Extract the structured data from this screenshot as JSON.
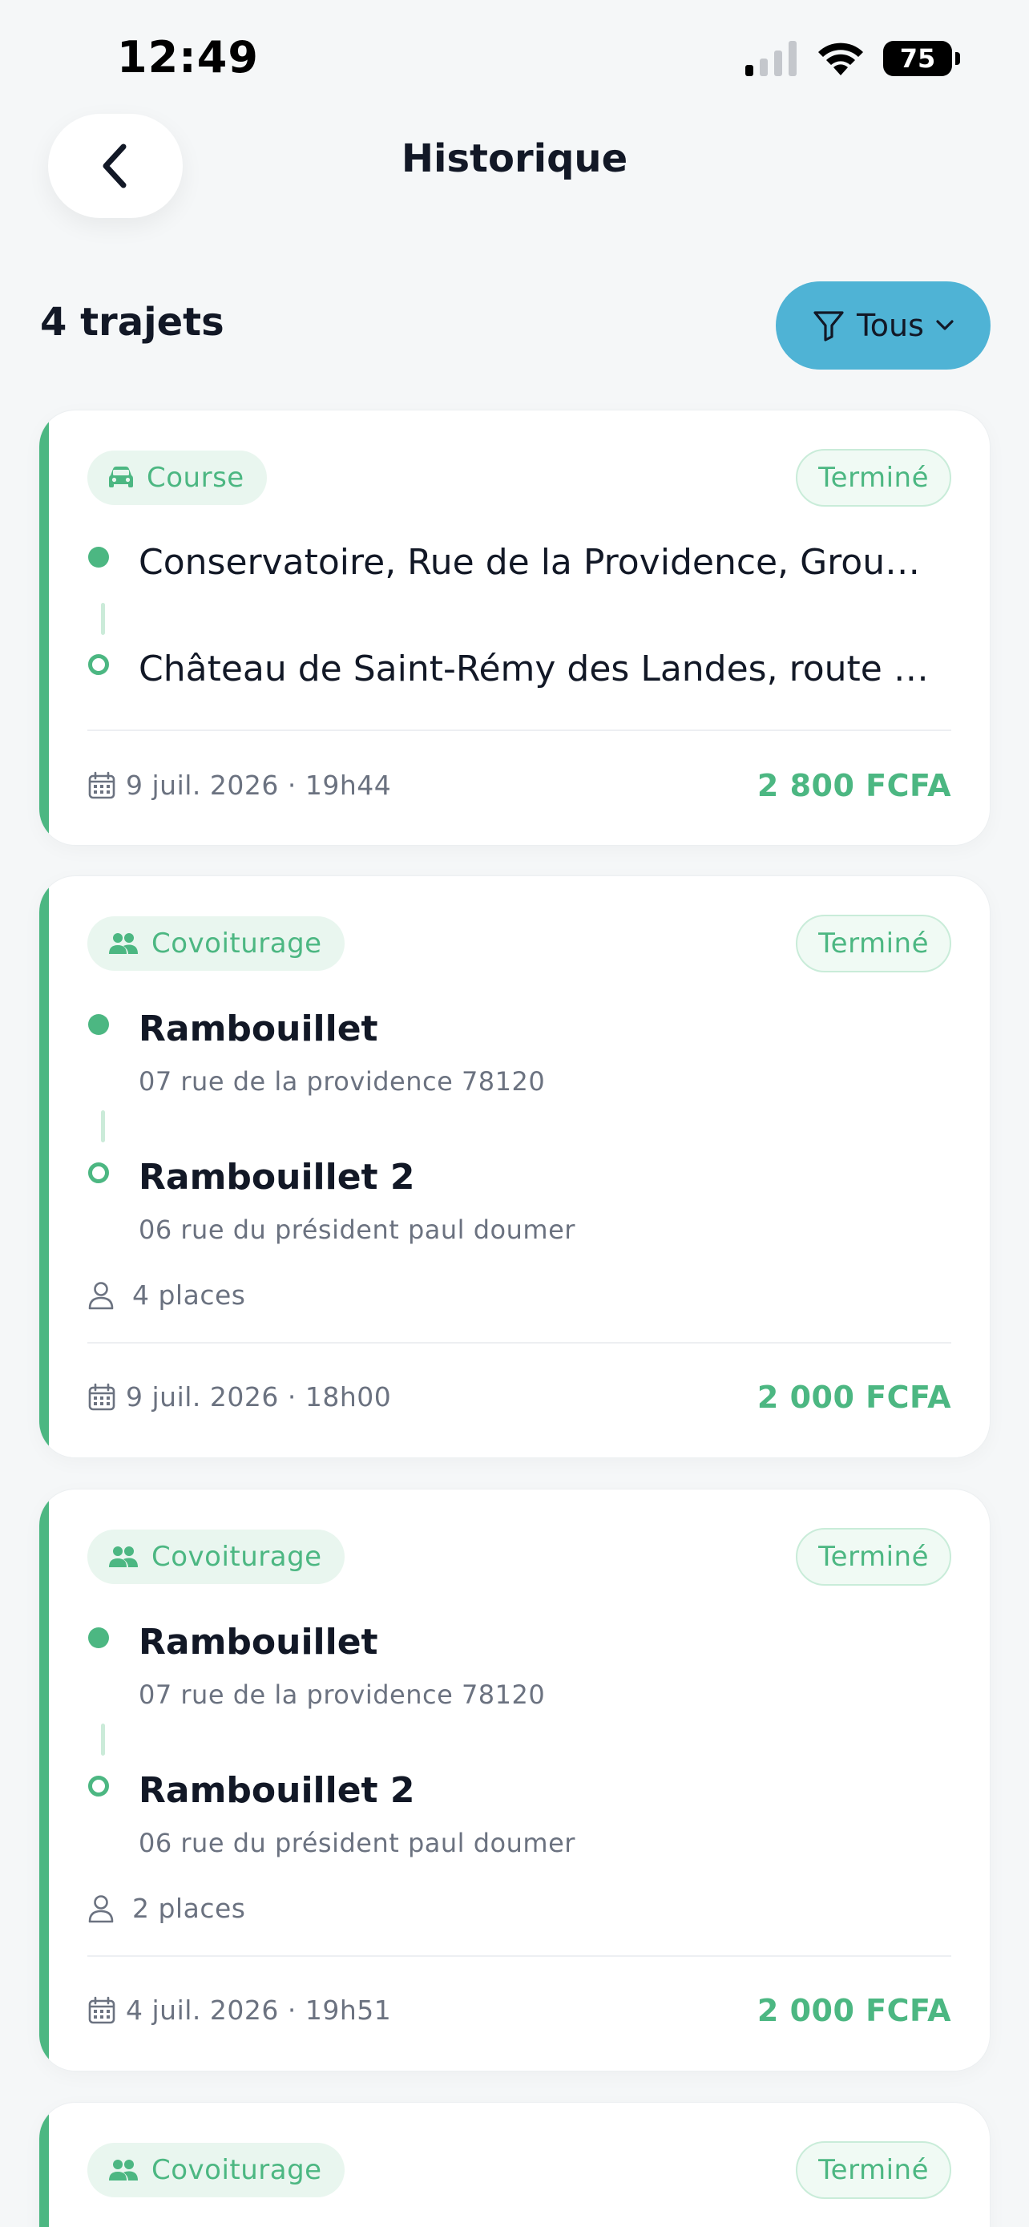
{
  "status_bar": {
    "time": "12:49",
    "battery": "75"
  },
  "header": {
    "title": "Historique"
  },
  "summary": {
    "count_label": "4 trajets",
    "filter_label": "Tous"
  },
  "colors": {
    "accent_green": "#4CB782",
    "filter_blue": "#4FB3D5",
    "background": "#F5F7F8"
  },
  "trips": [
    {
      "type_label": "Course",
      "type_icon": "car-icon",
      "status": "Terminé",
      "from": "Conservatoire, Rue de la Providence, Groupe Scolaire…",
      "to": "Château de Saint-Rémy des Landes, route de Sonchamp…",
      "date": "9 juil. 2026 · 19h44",
      "price": "2 800 FCFA"
    },
    {
      "type_label": "Covoiturage",
      "type_icon": "group-icon",
      "status": "Terminé",
      "from": "Rambouillet",
      "from_address": "07 rue de la providence 78120",
      "to": "Rambouillet 2",
      "to_address": "06 rue du président paul doumer",
      "seats": "4 places",
      "date": "9 juil. 2026 · 18h00",
      "price": "2 000 FCFA"
    },
    {
      "type_label": "Covoiturage",
      "type_icon": "group-icon",
      "status": "Terminé",
      "from": "Rambouillet",
      "from_address": "07 rue de la providence 78120",
      "to": "Rambouillet 2",
      "to_address": "06 rue du président paul doumer",
      "seats": "2 places",
      "date": "4 juil. 2026 · 19h51",
      "price": "2 000 FCFA"
    },
    {
      "type_label": "Covoiturage",
      "type_icon": "group-icon",
      "status": "Terminé"
    }
  ]
}
